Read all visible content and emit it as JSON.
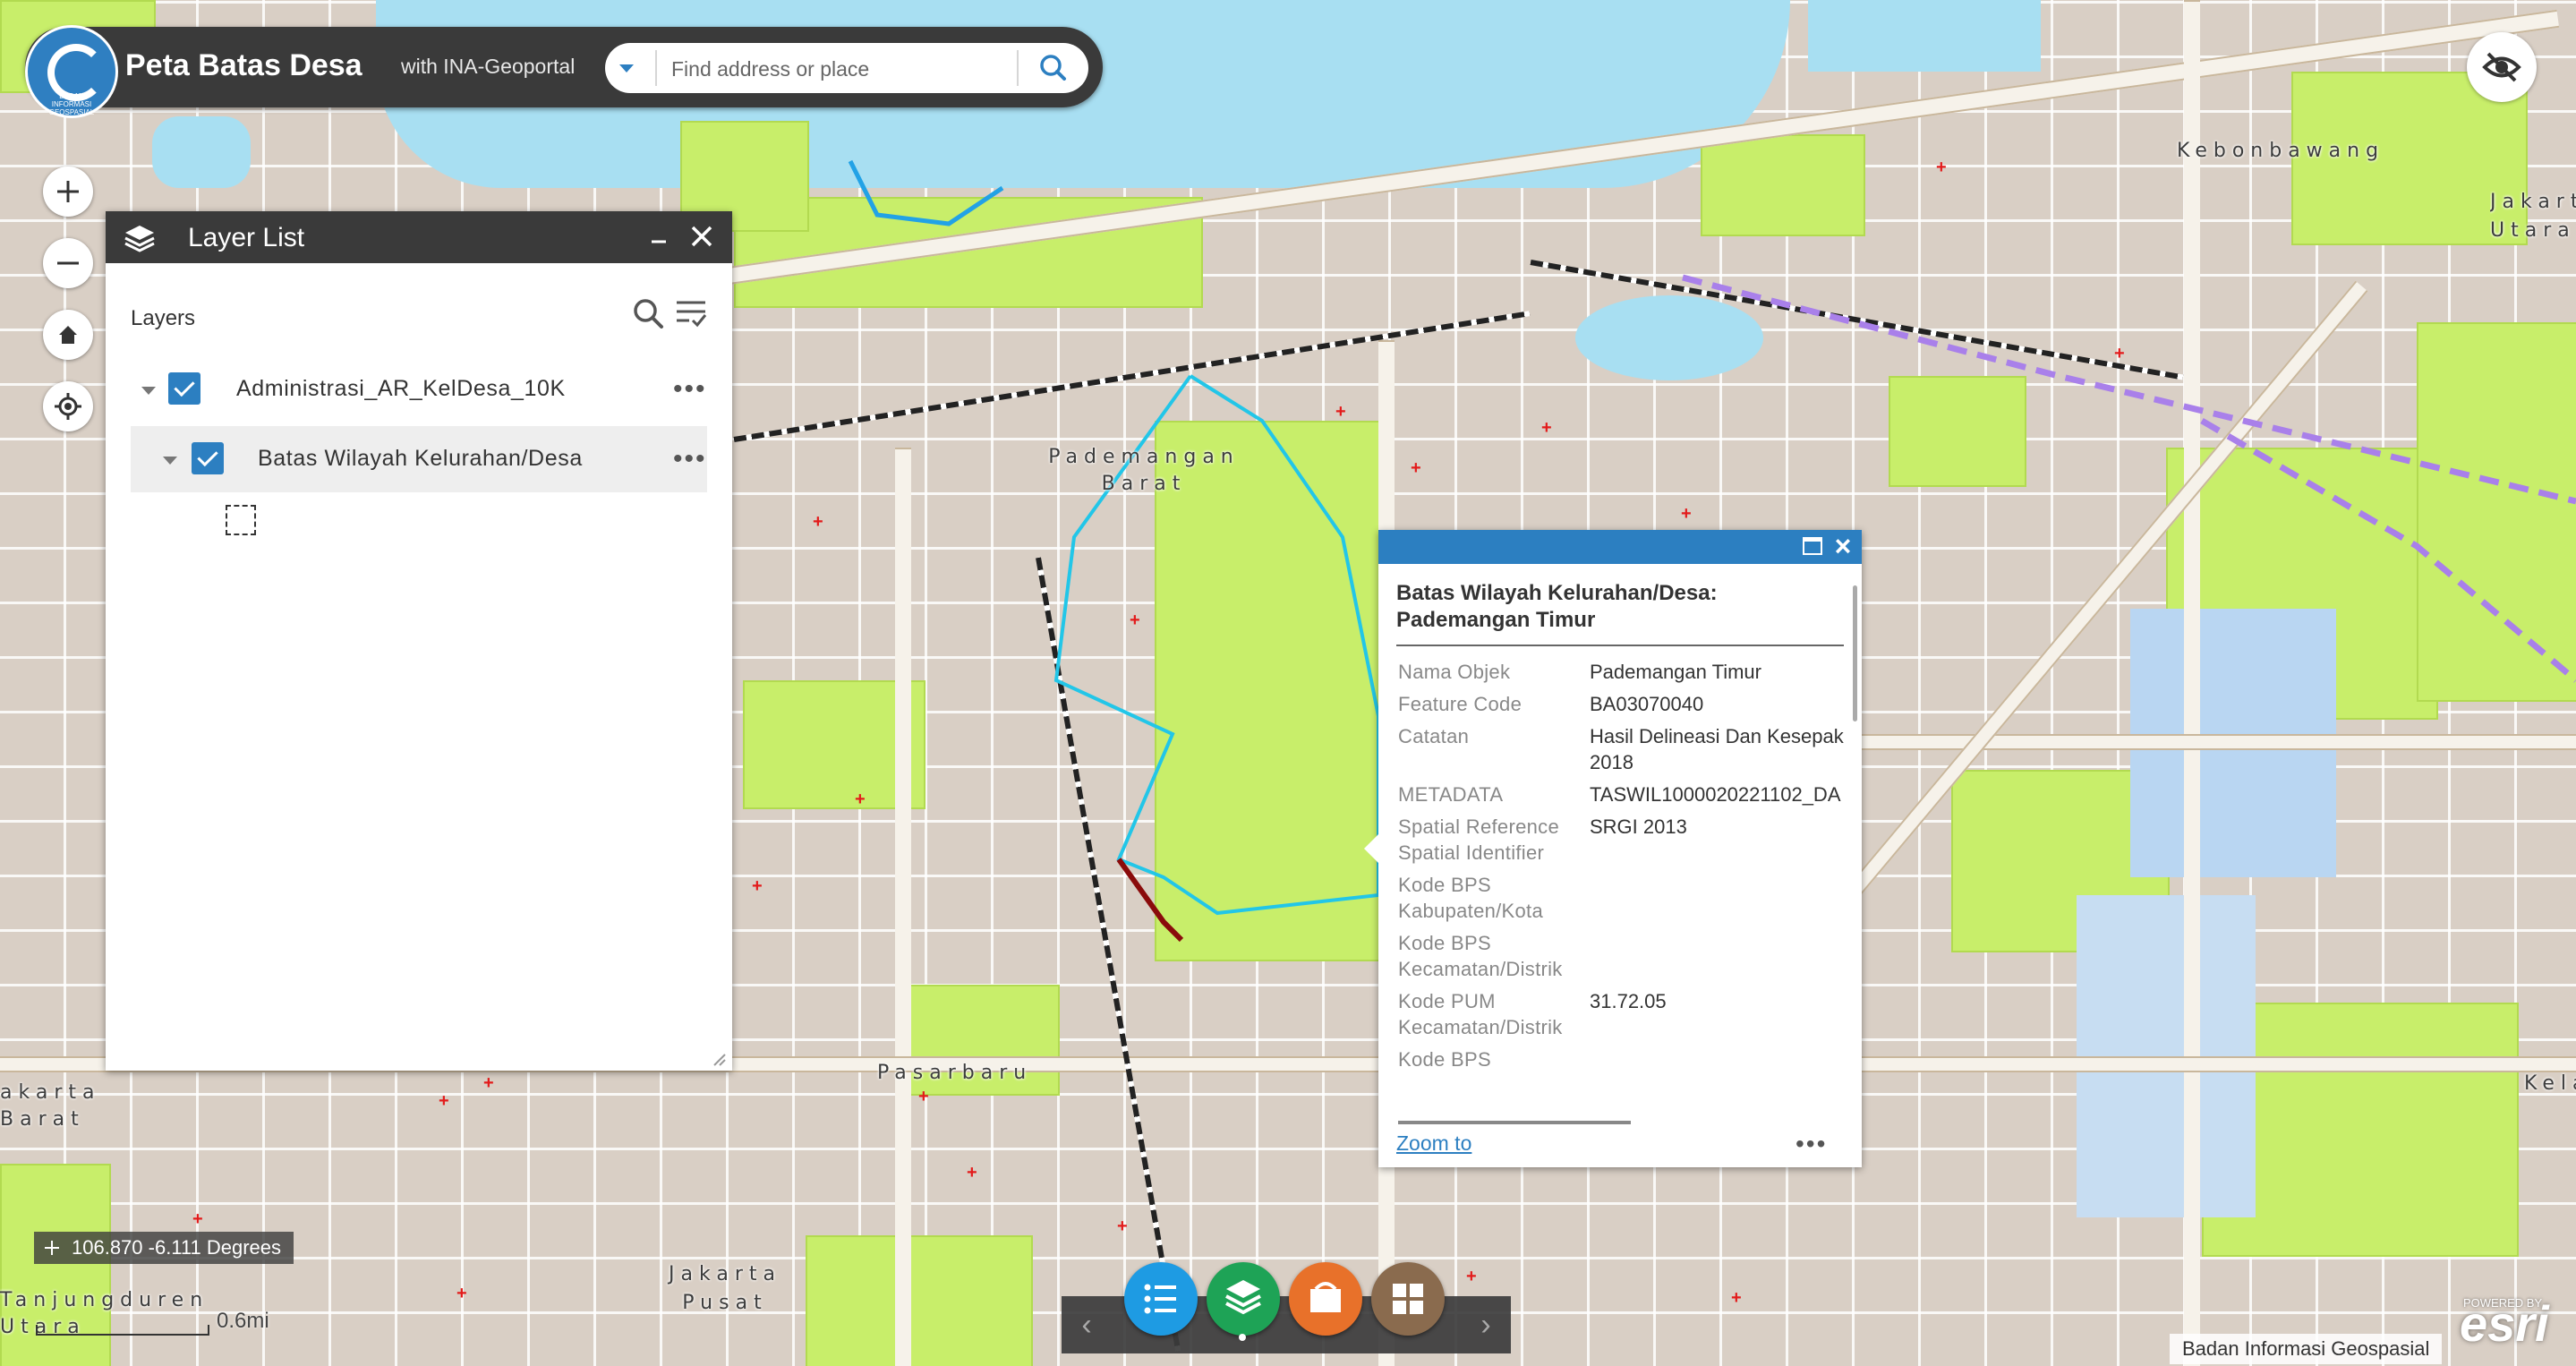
{
  "header": {
    "title": "Peta Batas Desa",
    "subtitle": "with INA-Geoportal",
    "logo_text": "BADAN INFORMASI GEOSPASIAL",
    "search_placeholder": "Find address or place"
  },
  "map": {
    "labels": {
      "kebonbawang": "Kebonbawang",
      "jakarta_utara": "Jakarta Utara",
      "pademangan_barat": "Pademangan Barat",
      "pasar_baru": "Pasarbaru",
      "jakarta_pusat": "Jakarta Pusat",
      "jakarta_barat": "akarta Barat",
      "tanjungduren": "Tanjungduren Utara",
      "kelapa": "Kela"
    }
  },
  "layer_list": {
    "title": "Layer List",
    "heading": "Layers",
    "layers": [
      {
        "label": "Administrasi_AR_KelDesa_10K",
        "checked": true
      },
      {
        "label": "Batas Wilayah Kelurahan/Desa",
        "checked": true
      }
    ]
  },
  "popup": {
    "title": "Batas Wilayah Kelurahan/Desa: Pademangan Timur",
    "fields": [
      {
        "key": "Nama Objek",
        "value": "Pademangan Timur"
      },
      {
        "key": "Feature Code",
        "value": "BA03070040"
      },
      {
        "key": "Catatan",
        "value": "Hasil Delineasi Dan Kesepak\n2018"
      },
      {
        "key": "METADATA",
        "value": "TASWIL1000020221102_DA"
      },
      {
        "key": "Spatial Reference\nSpatial Identifier",
        "value": "SRGI 2013"
      },
      {
        "key": "Kode BPS\nKabupaten/Kota",
        "value": ""
      },
      {
        "key": "Kode BPS\nKecamatan/Distrik",
        "value": ""
      },
      {
        "key": "Kode PUM\nKecamatan/Distrik",
        "value": "31.72.05"
      },
      {
        "key": "Kode BPS",
        "value": ""
      }
    ],
    "zoom_label": "Zoom to"
  },
  "status": {
    "coordinates": "106.870 -6.111 Degrees",
    "scale": "0.6mi",
    "attribution": "Badan Informasi Geospasial",
    "esri": "esri",
    "esri_powered": "POWERED BY"
  },
  "toolbar": {
    "buttons": [
      {
        "name": "legend",
        "color": "#1e9be3"
      },
      {
        "name": "layer-list",
        "color": "#1ea356"
      },
      {
        "name": "basemap",
        "color": "#e8712a"
      },
      {
        "name": "widgets-grid",
        "color": "#8a6b4e"
      }
    ]
  },
  "colors": {
    "accent": "#2c7fc1",
    "panel_header": "#3a3a3a",
    "park": "#c8ee6a",
    "water": "#a8dff2"
  }
}
